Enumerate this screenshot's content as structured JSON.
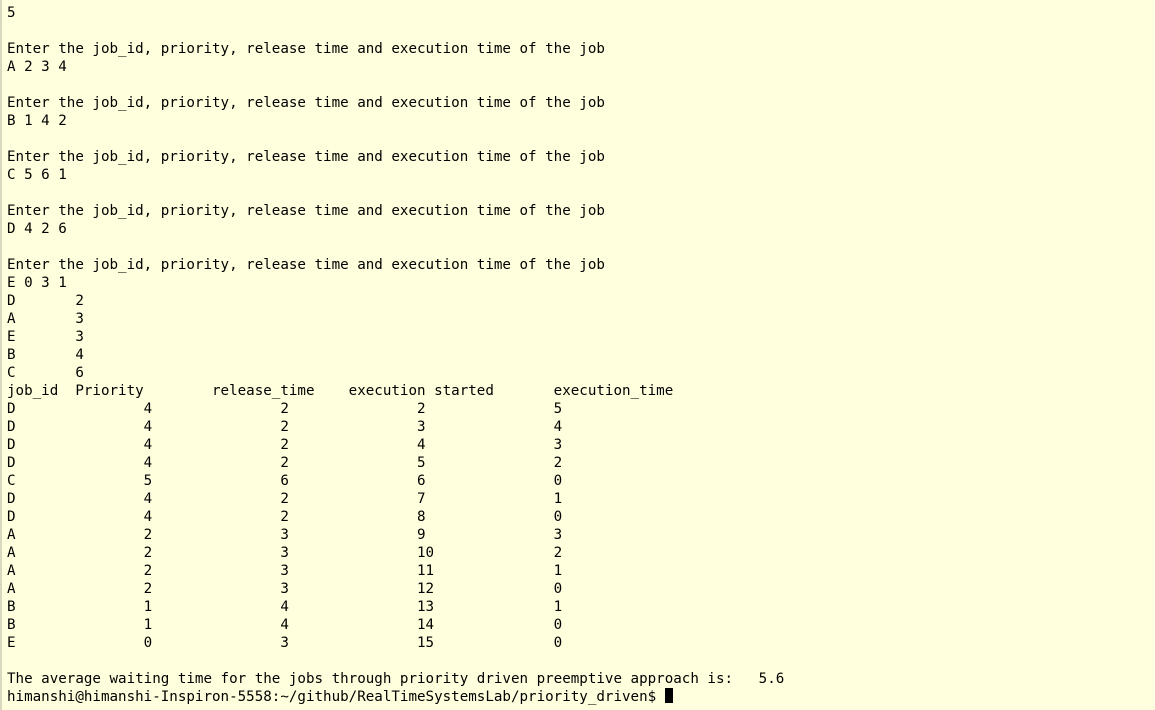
{
  "lines": [
    "5",
    "",
    "Enter the job_id, priority, release time and execution time of the job",
    "A 2 3 4",
    "",
    "Enter the job_id, priority, release time and execution time of the job",
    "B 1 4 2",
    "",
    "Enter the job_id, priority, release time and execution time of the job",
    "C 5 6 1",
    "",
    "Enter the job_id, priority, release time and execution time of the job",
    "D 4 2 6",
    "",
    "Enter the job_id, priority, release time and execution time of the job",
    "E 0 3 1",
    "D\t2",
    "A\t3",
    "E\t3",
    "B\t4",
    "C\t6",
    "job_id  Priority\trelease_time\texecution started\texecution_time",
    "D\t\t4\t\t2\t\t2\t\t5",
    "D\t\t4\t\t2\t\t3\t\t4",
    "D\t\t4\t\t2\t\t4\t\t3",
    "D\t\t4\t\t2\t\t5\t\t2",
    "C\t\t5\t\t6\t\t6\t\t0",
    "D\t\t4\t\t2\t\t7\t\t1",
    "D\t\t4\t\t2\t\t8\t\t0",
    "A\t\t2\t\t3\t\t9\t\t3",
    "A\t\t2\t\t3\t\t10\t\t2",
    "A\t\t2\t\t3\t\t11\t\t1",
    "A\t\t2\t\t3\t\t12\t\t0",
    "B\t\t1\t\t4\t\t13\t\t1",
    "B\t\t1\t\t4\t\t14\t\t0",
    "E\t\t0\t\t3\t\t15\t\t0",
    "",
    "The average waiting time for the jobs through priority driven preemptive approach is:\t5.6"
  ],
  "prompt": "himanshi@himanshi-Inspiron-5558:~/github/RealTimeSystemsLab/priority_driven$ "
}
